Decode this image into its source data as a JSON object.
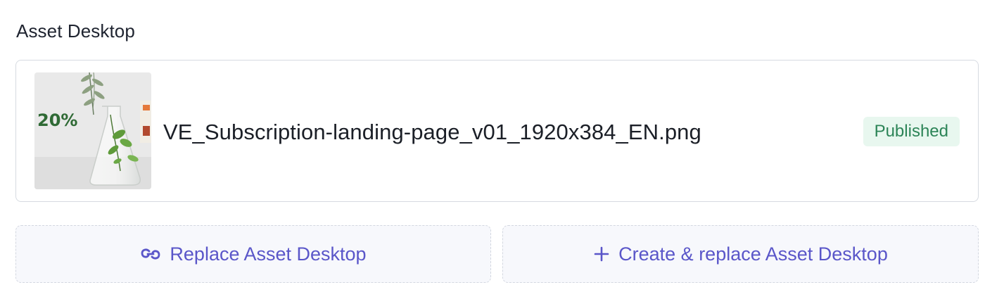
{
  "field": {
    "label": "Asset Desktop"
  },
  "asset": {
    "thumbnail": {
      "text": "20%",
      "icon": "image-thumbnail"
    },
    "file_name": "VE_Subscription-landing-page_v01_1920x384_EN.png",
    "status": "Published",
    "status_color": "#2c8457",
    "status_bg": "#e8f7ef"
  },
  "actions": {
    "replace": {
      "label": "Replace Asset Desktop",
      "icon": "link-icon"
    },
    "create_replace": {
      "label": "Create & replace Asset Desktop",
      "icon": "plus-icon"
    },
    "accent_color": "#5a56c9"
  }
}
